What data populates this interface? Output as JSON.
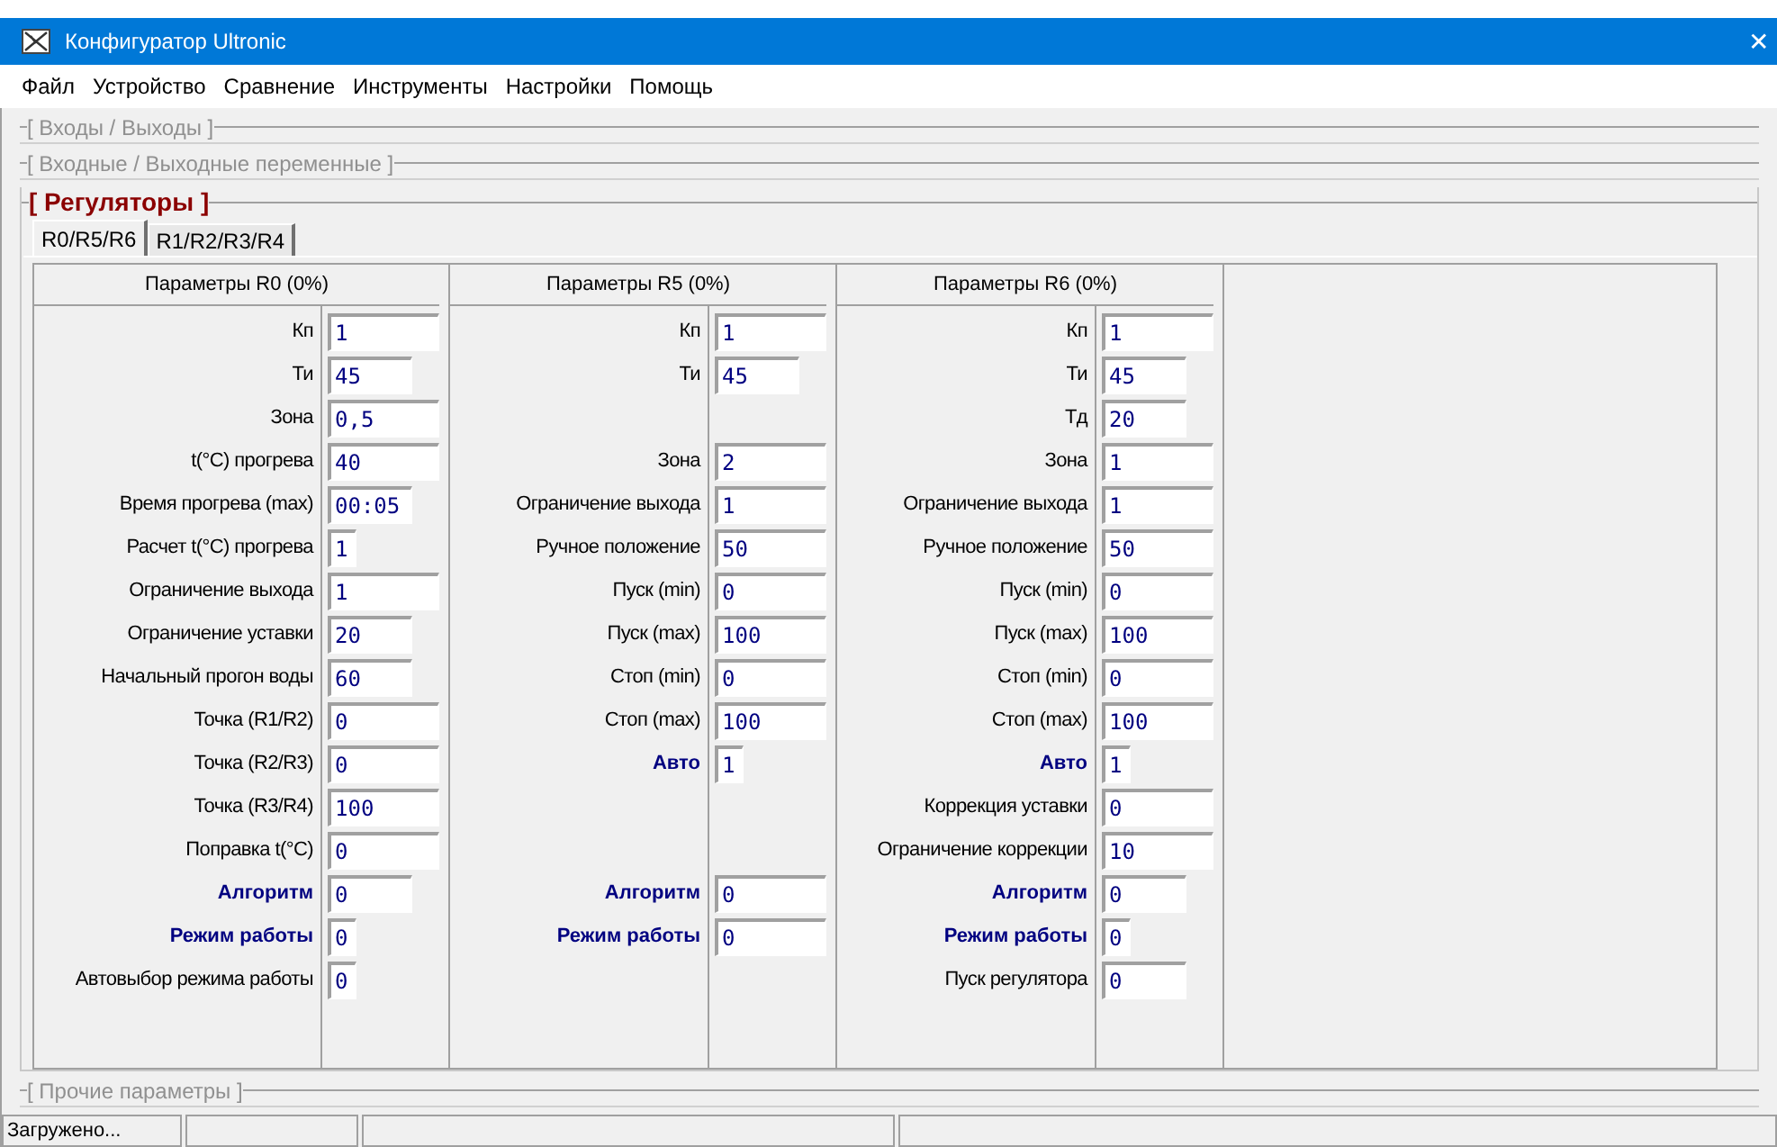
{
  "window": {
    "title": "Конфигуратор Ultronic",
    "close": "✕"
  },
  "menu": [
    "Файл",
    "Устройство",
    "Сравнение",
    "Инструменты",
    "Настройки",
    "Помощь"
  ],
  "groups_top": [
    {
      "title": "[ Входы / Выходы ]"
    },
    {
      "title": "[ Входные / Выходные переменные ]"
    }
  ],
  "regulators": {
    "title": "[ Регуляторы ]",
    "tabs": [
      {
        "label": "R0/R5/R6",
        "selected": true
      },
      {
        "label": "R1/R2/R3/R4",
        "selected": false
      }
    ],
    "panels": [
      {
        "header": "Параметры R0 (0%)",
        "rows": [
          {
            "kind": "wide",
            "label": "Кп",
            "value": "1",
            "emphasis": false
          },
          {
            "kind": "medium",
            "label": "Ти",
            "value": "45",
            "emphasis": false
          },
          {
            "kind": "wide",
            "label": "Зона",
            "value": "0,5",
            "emphasis": false
          },
          {
            "kind": "wide",
            "label": "t(°C) прогрева",
            "value": "40",
            "emphasis": false
          },
          {
            "kind": "medium",
            "label": "Время прогрева (max)",
            "value": "00:05",
            "emphasis": false
          },
          {
            "kind": "small",
            "label": "Расчет t(°C) прогрева",
            "value": "1",
            "emphasis": false
          },
          {
            "kind": "wide",
            "label": "Ограничение выхода",
            "value": "1",
            "emphasis": false
          },
          {
            "kind": "medium",
            "label": "Ограничение уставки",
            "value": "20",
            "emphasis": false
          },
          {
            "kind": "medium",
            "label": "Начальный прогон воды",
            "value": "60",
            "emphasis": false
          },
          {
            "kind": "wide",
            "label": "Точка (R1/R2)",
            "value": "0",
            "emphasis": false
          },
          {
            "kind": "wide",
            "label": "Точка (R2/R3)",
            "value": "0",
            "emphasis": false
          },
          {
            "kind": "wide",
            "label": "Точка (R3/R4)",
            "value": "100",
            "emphasis": false
          },
          {
            "kind": "wide",
            "label": "Поправка t(°C)",
            "value": "0",
            "emphasis": false
          },
          {
            "kind": "medium",
            "label": "Алгоритм",
            "value": "0",
            "emphasis": true
          },
          {
            "kind": "small",
            "label": "Режим работы",
            "value": "0",
            "emphasis": true
          },
          {
            "kind": "small",
            "label": "Автовыбор режима работы",
            "value": "0",
            "emphasis": false
          }
        ]
      },
      {
        "header": "Параметры R5 (0%)",
        "rows": [
          {
            "kind": "wide",
            "label": "Кп",
            "value": "1",
            "emphasis": false
          },
          {
            "kind": "medium",
            "label": "Ти",
            "value": "45",
            "emphasis": false
          },
          {
            "kind": "gap"
          },
          {
            "kind": "wide",
            "label": "Зона",
            "value": "2",
            "emphasis": false
          },
          {
            "kind": "wide",
            "label": "Ограничение выхода",
            "value": "1",
            "emphasis": false
          },
          {
            "kind": "wide",
            "label": "Ручное положение",
            "value": "50",
            "emphasis": false
          },
          {
            "kind": "wide",
            "label": "Пуск (min)",
            "value": "0",
            "emphasis": false
          },
          {
            "kind": "wide",
            "label": "Пуск (max)",
            "value": "100",
            "emphasis": false
          },
          {
            "kind": "wide",
            "label": "Стоп (min)",
            "value": "0",
            "emphasis": false
          },
          {
            "kind": "wide",
            "label": "Стоп (max)",
            "value": "100",
            "emphasis": false
          },
          {
            "kind": "small",
            "label": "Авто",
            "value": "1",
            "emphasis": true
          },
          {
            "kind": "gap"
          },
          {
            "kind": "gap"
          },
          {
            "kind": "wide",
            "label": "Алгоритм",
            "value": "0",
            "emphasis": true
          },
          {
            "kind": "wide",
            "label": "Режим работы",
            "value": "0",
            "emphasis": true
          }
        ]
      },
      {
        "header": "Параметры R6 (0%)",
        "rows": [
          {
            "kind": "wide",
            "label": "Кп",
            "value": "1",
            "emphasis": false
          },
          {
            "kind": "medium",
            "label": "Ти",
            "value": "45",
            "emphasis": false
          },
          {
            "kind": "medium",
            "label": "Тд",
            "value": "20",
            "emphasis": false
          },
          {
            "kind": "wide",
            "label": "Зона",
            "value": "1",
            "emphasis": false
          },
          {
            "kind": "wide",
            "label": "Ограничение выхода",
            "value": "1",
            "emphasis": false
          },
          {
            "kind": "wide",
            "label": "Ручное положение",
            "value": "50",
            "emphasis": false
          },
          {
            "kind": "wide",
            "label": "Пуск (min)",
            "value": "0",
            "emphasis": false
          },
          {
            "kind": "wide",
            "label": "Пуск (max)",
            "value": "100",
            "emphasis": false
          },
          {
            "kind": "wide",
            "label": "Стоп (min)",
            "value": "0",
            "emphasis": false
          },
          {
            "kind": "wide",
            "label": "Стоп (max)",
            "value": "100",
            "emphasis": false
          },
          {
            "kind": "small",
            "label": "Авто",
            "value": "1",
            "emphasis": true
          },
          {
            "kind": "wide",
            "label": "Коррекция уставки",
            "value": "0",
            "emphasis": false
          },
          {
            "kind": "wide",
            "label": "Ограничение коррекции",
            "value": "10",
            "emphasis": false
          },
          {
            "kind": "medium",
            "label": "Алгоритм",
            "value": "0",
            "emphasis": true
          },
          {
            "kind": "small",
            "label": "Режим работы",
            "value": "0",
            "emphasis": true
          },
          {
            "kind": "medium",
            "label": "Пуск регулятора",
            "value": "0",
            "emphasis": false
          }
        ]
      }
    ]
  },
  "groups_bottom": [
    {
      "title": "[ Прочие параметры ]"
    }
  ],
  "status_bar": [
    "Загружено..."
  ]
}
